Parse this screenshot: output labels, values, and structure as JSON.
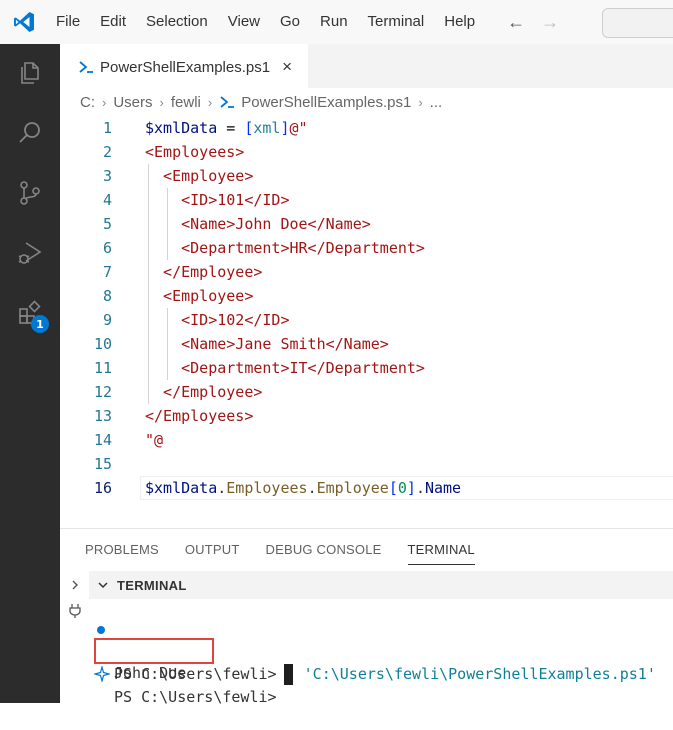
{
  "menu": {
    "items": [
      "File",
      "Edit",
      "Selection",
      "View",
      "Go",
      "Run",
      "Terminal",
      "Help"
    ]
  },
  "nav": {
    "back": "←",
    "forward": "→"
  },
  "activity_bar": {
    "icons": [
      "explorer-icon",
      "search-icon",
      "source-control-icon",
      "run-debug-icon",
      "extensions-icon"
    ],
    "extensions_badge": "1"
  },
  "tab": {
    "label": "PowerShellExamples.ps1",
    "close": "×"
  },
  "breadcrumb": {
    "parts": [
      "C:",
      "Users",
      "fewli",
      "PowerShellExamples.ps1",
      "..."
    ]
  },
  "editor": {
    "line_numbers": [
      "1",
      "2",
      "3",
      "4",
      "5",
      "6",
      "7",
      "8",
      "9",
      "10",
      "11",
      "12",
      "13",
      "14",
      "15",
      "16"
    ],
    "lines": [
      [
        {
          "t": "$xmlData",
          "c": "var"
        },
        {
          "t": " = ",
          "c": "op"
        },
        {
          "t": "[",
          "c": "bracket"
        },
        {
          "t": "xml",
          "c": "type"
        },
        {
          "t": "]",
          "c": "bracket"
        },
        {
          "t": "@\"",
          "c": "str"
        }
      ],
      [
        {
          "t": "<Employees>",
          "c": "str"
        }
      ],
      [
        {
          "t": "  <Employee>",
          "c": "str"
        }
      ],
      [
        {
          "t": "    <ID>101</ID>",
          "c": "str"
        }
      ],
      [
        {
          "t": "    <Name>John Doe</Name>",
          "c": "str"
        }
      ],
      [
        {
          "t": "    <Department>HR</Department>",
          "c": "str"
        }
      ],
      [
        {
          "t": "  </Employee>",
          "c": "str"
        }
      ],
      [
        {
          "t": "  <Employee>",
          "c": "str"
        }
      ],
      [
        {
          "t": "    <ID>102</ID>",
          "c": "str"
        }
      ],
      [
        {
          "t": "    <Name>Jane Smith</Name>",
          "c": "str"
        }
      ],
      [
        {
          "t": "    <Department>IT</Department>",
          "c": "str"
        }
      ],
      [
        {
          "t": "  </Employee>",
          "c": "str"
        }
      ],
      [
        {
          "t": "</Employees>",
          "c": "str"
        }
      ],
      [
        {
          "t": "\"@",
          "c": "str"
        }
      ],
      [],
      [
        {
          "t": "$xmlData",
          "c": "var"
        },
        {
          "t": ".",
          "c": "dot"
        },
        {
          "t": "Employees",
          "c": "prop"
        },
        {
          "t": ".",
          "c": "dot"
        },
        {
          "t": "Employee",
          "c": "prop"
        },
        {
          "t": "[",
          "c": "bracket"
        },
        {
          "t": "0",
          "c": "num"
        },
        {
          "t": "]",
          "c": "bracket"
        },
        {
          "t": ".",
          "c": "dot"
        },
        {
          "t": "Name",
          "c": "var"
        }
      ]
    ],
    "current_line": 16
  },
  "panel": {
    "tabs": [
      "PROBLEMS",
      "OUTPUT",
      "DEBUG CONSOLE",
      "TERMINAL"
    ],
    "active_tab": "TERMINAL",
    "terminal_title": "TERMINAL"
  },
  "terminal": {
    "prompt1": "PS C:\\Users\\fewli> ",
    "command_dot": ". ",
    "command_path": "'C:\\Users\\fewli\\PowerShellExamples.ps1'",
    "output": "John Doe",
    "prompt2": "PS C:\\Users\\fewli> "
  },
  "colors": {
    "accent": "#0078d4",
    "highlight_box": "#e0443c",
    "activity_bar": "#2c2c2c"
  }
}
